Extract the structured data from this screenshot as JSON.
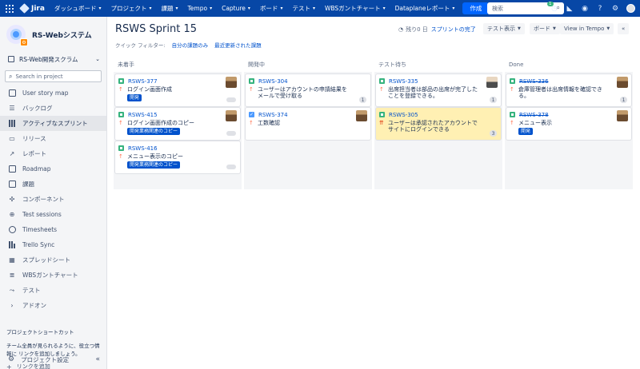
{
  "topnav": {
    "logo": "Jira",
    "items": [
      "ダッシュボード",
      "プロジェクト",
      "課題",
      "Tempo",
      "Capture",
      "ボード",
      "テスト",
      "WBSガントチャート",
      "Dataplaneレポート"
    ],
    "create": "作成",
    "search_placeholder": "検索",
    "notification_count": "1"
  },
  "sidebar": {
    "project_name": "RS-Webシステム",
    "board": "RS-Web開発スクラム",
    "search_placeholder": "Search in project",
    "items": [
      {
        "label": "User story map",
        "icon": "map-icon"
      },
      {
        "label": "バックログ",
        "icon": "backlog-icon"
      },
      {
        "label": "アクティブなスプリント",
        "icon": "board-icon",
        "active": true
      },
      {
        "label": "リリース",
        "icon": "release-icon"
      },
      {
        "label": "レポート",
        "icon": "reports-icon"
      },
      {
        "label": "Roadmap",
        "icon": "roadmap-icon"
      },
      {
        "label": "課題",
        "icon": "issues-icon"
      },
      {
        "label": "コンポーネント",
        "icon": "components-icon"
      },
      {
        "label": "Test sessions",
        "icon": "test-sessions-icon"
      },
      {
        "label": "Timesheets",
        "icon": "timesheets-icon"
      },
      {
        "label": "Trello Sync",
        "icon": "trello-icon"
      },
      {
        "label": "スプレッドシート",
        "icon": "spreadsheet-icon"
      },
      {
        "label": "WBSガントチャート",
        "icon": "gantt-icon"
      },
      {
        "label": "テスト",
        "icon": "test-icon"
      },
      {
        "label": "アドオン",
        "icon": "chevron-right-icon"
      }
    ],
    "shortcut_heading": "プロジェクトショートカット",
    "shortcut_desc": "チーム全員が見られるように、役立つ情報に リンクを追加しましょう。",
    "add_link": "リンクを追加",
    "settings": "プロジェクト設定"
  },
  "main": {
    "title": "RSWS Sprint 15",
    "quick_filter_label": "クイック フィルター:",
    "quick_filters": [
      "自分の課題のみ",
      "最近更新された課題"
    ],
    "remaining": "残り0 日",
    "complete_sprint": "スプリントの完了",
    "buttons": {
      "view": "テスト表示",
      "board": "ボード",
      "tempo": "View in Tempo"
    },
    "columns": [
      {
        "name": "未着手",
        "cards": [
          {
            "key": "RSWS-377",
            "type": "story",
            "summary": "ログイン画面作成",
            "epic": "開発",
            "done": false
          },
          {
            "key": "RSWS-415",
            "type": "story",
            "summary": "ログイン画面作成のコピー",
            "epic": "開発業務関連のコピー",
            "done": false
          },
          {
            "key": "RSWS-416",
            "type": "story",
            "summary": "メニュー表示のコピー",
            "epic": "開発業務関連のコピー",
            "done": false
          }
        ]
      },
      {
        "name": "開発中",
        "cards": [
          {
            "key": "RSWS-304",
            "type": "story",
            "summary": "ユーザーはアカウントの申請結果をメールで受け取る",
            "count": "1",
            "done": false
          },
          {
            "key": "RSWS-374",
            "type": "task",
            "summary": "工数確認",
            "done": false
          }
        ]
      },
      {
        "name": "テスト待ち",
        "cards": [
          {
            "key": "RSWS-335",
            "type": "story",
            "summary": "出席担当者は部品の出席が完了したことを登録できる。",
            "count": "1",
            "done": false
          },
          {
            "key": "RSWS-305",
            "type": "story",
            "summary": "ユーザーは承認されたアカウントでサイトにログインできる",
            "count": "3",
            "done": false,
            "highlight": true
          }
        ]
      },
      {
        "name": "Done",
        "cards": [
          {
            "key": "RSWS-336",
            "type": "story",
            "summary": "倉庫管理者は出席情報を確認できる。",
            "count": "1",
            "done": true
          },
          {
            "key": "RSWS-378",
            "type": "story",
            "summary": "メニュー表示",
            "epic": "開発",
            "done": true
          }
        ]
      }
    ]
  }
}
